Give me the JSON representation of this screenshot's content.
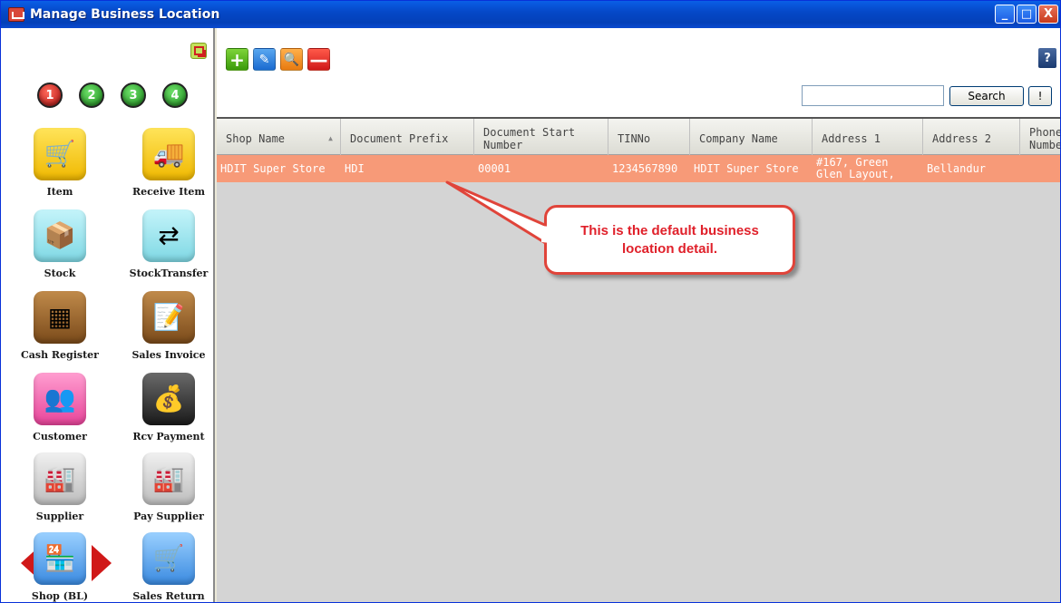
{
  "window": {
    "title": "Manage Business Location",
    "controls": [
      "_",
      "□",
      "X"
    ]
  },
  "sidebar": {
    "steps": [
      "1",
      "2",
      "3",
      "4"
    ],
    "items": [
      {
        "label": "Item",
        "icon": "shopping-cart-icon"
      },
      {
        "label": "Receive Item",
        "icon": "truck-icon"
      },
      {
        "label": "Stock",
        "icon": "hand-truck-icon"
      },
      {
        "label": "StockTransfer",
        "icon": "transfer-boxes-icon"
      },
      {
        "label": "Cash Register",
        "icon": "cash-register-icon"
      },
      {
        "label": "Sales Invoice",
        "icon": "invoice-icon"
      },
      {
        "label": "Customer",
        "icon": "customers-icon"
      },
      {
        "label": "Rcv Payment",
        "icon": "money-bag-icon"
      },
      {
        "label": "Supplier",
        "icon": "factory-icon"
      },
      {
        "label": "Pay Supplier",
        "icon": "factory-arrow-icon"
      },
      {
        "label": "Shop (BL)",
        "icon": "shop-icon"
      },
      {
        "label": "Sales Return",
        "icon": "cart-return-icon"
      }
    ]
  },
  "toolbar": {
    "add": "+",
    "edit": "✎",
    "find": "🔍",
    "delete": "—",
    "help": "?"
  },
  "search": {
    "value": "",
    "button_label": "Search",
    "clear_label": "!"
  },
  "grid": {
    "columns": [
      "Shop Name",
      "Document Prefix",
      "Document Start Number",
      "TINNo",
      "Company Name",
      "Address 1",
      "Address 2",
      "Phone Number"
    ],
    "rows": [
      [
        "HDIT Super Store",
        "HDI",
        "00001",
        "1234567890",
        "HDIT Super Store",
        "#167, Green Glen Layout,",
        "Bellandur",
        ""
      ]
    ]
  },
  "callout": {
    "text": "This is the default business location detail."
  },
  "colors": {
    "selected_row": "#f79a78",
    "callout_border": "#e0443a",
    "callout_text": "#e0202a"
  }
}
